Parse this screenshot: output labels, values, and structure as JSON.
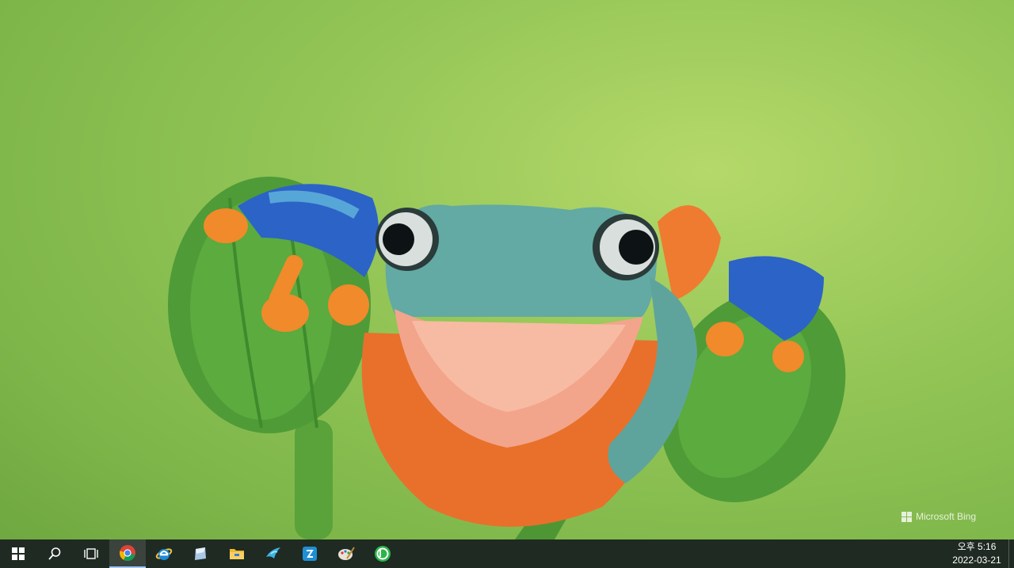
{
  "wallpaper": {
    "subject": "frog-on-flower-buds",
    "watermark": "Microsoft Bing"
  },
  "taskbar": {
    "buttons": [
      {
        "icon": "windows-start-icon"
      },
      {
        "icon": "search-icon"
      },
      {
        "icon": "task-view-icon"
      },
      {
        "icon": "chrome-icon",
        "active": true
      },
      {
        "icon": "internet-explorer-icon"
      },
      {
        "icon": "eraser-tool-icon"
      },
      {
        "icon": "file-explorer-icon"
      },
      {
        "icon": "bird-app-icon"
      },
      {
        "icon": "blue-app-icon"
      },
      {
        "icon": "paint-palette-icon"
      },
      {
        "icon": "green-b-app-icon"
      }
    ],
    "clock": {
      "time": "오후 5:16",
      "date": "2022-03-21"
    }
  },
  "colors": {
    "taskbar": "#1f2a22",
    "wallpaper_green": "#8ec453",
    "frog_teal": "#5fa7a0",
    "frog_orange": "#f07a2a",
    "frog_blue": "#2c63c7"
  }
}
